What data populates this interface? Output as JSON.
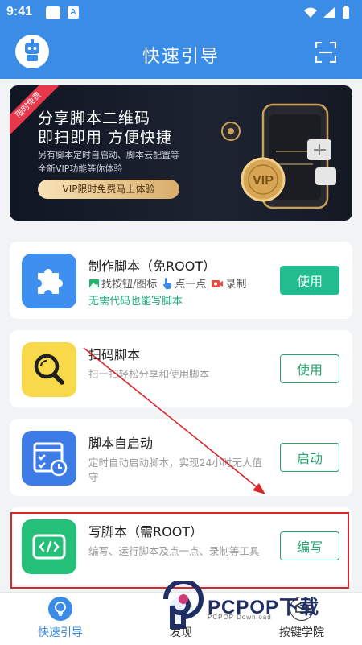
{
  "status_bar": {
    "time": "9:41",
    "badge_letter": "A"
  },
  "header": {
    "title": "快速引导"
  },
  "banner": {
    "ribbon": "限时免费",
    "title_line1": "分享脚本二维码",
    "title_line2": "即扫即用 方便快捷",
    "subtitle_line1": "另有脚本定时自启动、脚本云配置等",
    "subtitle_line2": "全新VIP功能等你体验",
    "cta": "VIP限时免费马上体验",
    "art_text": "VIP"
  },
  "cards": [
    {
      "title": "制作脚本（免ROOT）",
      "features": [
        {
          "icon": "image-icon",
          "label": "找按钮/图标"
        },
        {
          "icon": "tap-hand-icon",
          "label": "点一点"
        },
        {
          "icon": "record-camera-icon",
          "label": "录制"
        }
      ],
      "note": "无需代码也能写脚本",
      "button": "使用",
      "icon": "puzzle-icon",
      "color": "#3e8ff0"
    },
    {
      "title": "扫码脚本",
      "desc": "扫一扫轻松分享和使用脚本",
      "button": "使用",
      "icon": "magnifier-icon",
      "color": "#f8d94a"
    },
    {
      "title": "脚本自启动",
      "desc": "定时自动启动脚本，实现24小时无人值守",
      "button": "启动",
      "icon": "scheduled-checklist-icon",
      "color": "#3d7be6"
    },
    {
      "title": "写脚本（需ROOT）",
      "desc": "编写、运行脚本及点一点、录制等工具",
      "button": "编写",
      "icon": "code-window-icon",
      "color": "#24c07a"
    }
  ],
  "bottom_nav": [
    {
      "label": "快速引导",
      "icon": "bulb-icon",
      "active": true
    },
    {
      "label": "发现",
      "icon": "discover-icon",
      "active": false
    },
    {
      "label": "按键学院",
      "icon": "school-icon",
      "active": false
    }
  ],
  "watermark": {
    "text": "PCPOP下载",
    "sub": "PCPOP Download"
  },
  "colors": {
    "primary": "#3a8ce6",
    "green": "#21bd8e",
    "red_annotation": "#d9262c"
  }
}
